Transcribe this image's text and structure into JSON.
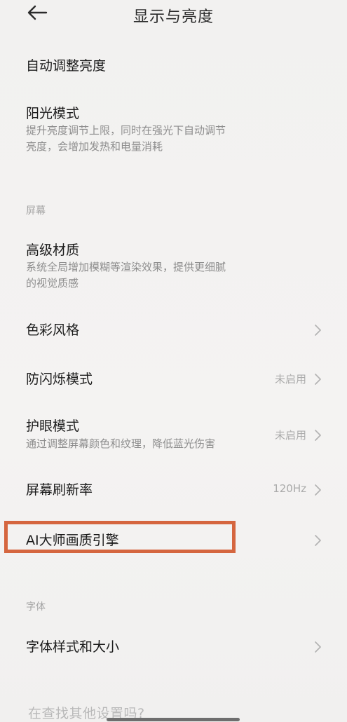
{
  "header": {
    "title": "显示与亮度",
    "back_icon": "arrow-left-icon"
  },
  "settings": {
    "auto_brightness": {
      "title": "自动调整亮度"
    },
    "sunlight_mode": {
      "title": "阳光模式",
      "description_line1": "提升亮度调节上限，同时在强光下自动调节",
      "description_line2": "亮度，会增加发热和电量消耗"
    },
    "screen_section": {
      "label": "屏幕"
    },
    "advanced_material": {
      "title": "高级材质",
      "description_line1": "系统全局增加模糊等渲染效果，提供更细腻",
      "description_line2": "的视觉质感"
    },
    "color_style": {
      "title": "色彩风格"
    },
    "anti_flicker": {
      "title": "防闪烁模式",
      "value": "未启用"
    },
    "eye_care": {
      "title": "护眼模式",
      "description": "通过调整屏幕颜色和纹理，降低蓝光伤害",
      "value": "未启用"
    },
    "refresh_rate": {
      "title": "屏幕刷新率",
      "value": "120Hz"
    },
    "ai_engine": {
      "title": "AI大师画质引擎"
    },
    "font_section": {
      "label": "字体"
    },
    "font_style": {
      "title": "字体样式和大小"
    }
  },
  "footer": {
    "hint": "在查找其他设置吗?"
  },
  "colors": {
    "background": "#f3f2f1",
    "highlight_border": "#d5663f",
    "secondary_text": "#8d8d8d",
    "value_text": "#aaaaaa"
  }
}
